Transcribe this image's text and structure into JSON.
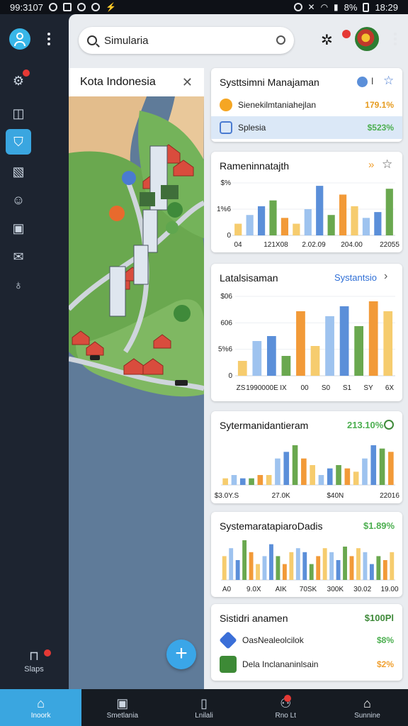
{
  "status_bar": {
    "time_left": "99:3107",
    "battery": "8%",
    "time_right": "18:29"
  },
  "search": {
    "placeholder": "Simularia"
  },
  "map": {
    "title": "Kota Indonesia"
  },
  "cards": {
    "card1": {
      "title": "Systtsimni Manajaman",
      "rows": [
        {
          "label": "Sienekilmtaniahejlan",
          "value": "179.1%",
          "color": "#f5a623"
        },
        {
          "label": "Splesia",
          "value": "$523%",
          "color": "#4caf50"
        }
      ]
    },
    "card2": {
      "title": "Rameninnatajth"
    },
    "card3": {
      "title": "Latalsisaman",
      "action": "Systantsio"
    },
    "card4": {
      "title": "Sytermanidantieram",
      "value": "213.10%"
    },
    "card5": {
      "title": "SystemaratapiaroDadis",
      "value": "$1.89%"
    },
    "card6": {
      "title": "Sistidri anamen",
      "value": "$100Pl",
      "rows": [
        {
          "label": "OasNealeolcilok",
          "value": "$8%"
        },
        {
          "label": "Dela Inclananinlsain",
          "value": "$2%"
        }
      ]
    }
  },
  "chart_data": [
    {
      "type": "bar",
      "title": "Rameninnatajth",
      "y_ticks": [
        "$%",
        "1%6",
        "0"
      ],
      "x_ticks": [
        "04",
        "121X08",
        "2.02.09",
        "204.00",
        "22055"
      ],
      "values": [
        2,
        3.5,
        5,
        6,
        3,
        2,
        4.5,
        8.5,
        3.5,
        7,
        5,
        3,
        4,
        8
      ]
    },
    {
      "type": "bar",
      "title": "Latalsisaman",
      "y_ticks": [
        "$06",
        "606",
        "5%6",
        "0"
      ],
      "x_ticks": [
        "ZS",
        "1990000E",
        "IX",
        "00",
        "S0",
        "S1",
        "SY",
        "6X"
      ],
      "values": [
        1.5,
        3.5,
        4,
        2,
        6.5,
        3,
        6,
        7,
        5,
        7.5,
        6.5
      ]
    },
    {
      "type": "bar",
      "title": "Sytermanidantieram",
      "x_ticks": [
        "$3.0Y.S",
        "27.0K",
        "$40N",
        "22016"
      ],
      "values": [
        1,
        1.5,
        1,
        1,
        1.5,
        1.5,
        4,
        5,
        6,
        4,
        3,
        1.5,
        2.5,
        3,
        2.5,
        2,
        4,
        6,
        5.5,
        5
      ]
    },
    {
      "type": "bar",
      "title": "SystemaratapiaroDadis",
      "x_ticks": [
        "A0",
        "9.0X",
        "AIK",
        "70SK",
        "300K",
        "30.02",
        "19.00"
      ],
      "values": [
        3,
        4,
        2.5,
        5,
        3.5,
        2,
        3,
        4.5,
        3,
        2,
        3.5,
        4,
        3.5,
        2,
        3,
        4,
        3.5,
        2.5,
        4.2,
        3,
        4,
        3.5,
        2,
        3,
        2.5,
        3.5
      ]
    }
  ],
  "bottom_nav": [
    {
      "label": "Inoork",
      "active": true
    },
    {
      "label": "Smetlania",
      "active": false
    },
    {
      "label": "Lnilali",
      "active": false
    },
    {
      "label": "Rno Lt",
      "active": false,
      "badge": true
    },
    {
      "label": "Sunnine",
      "active": false
    }
  ],
  "rail": {
    "bottom_label": "Slaps"
  },
  "colors": {
    "accent": "#3aa6e0",
    "blue": "#5b8fd9",
    "light_blue": "#9ec3ef",
    "yellow": "#f6cc6e",
    "orange": "#f29a38",
    "green": "#6aa84f",
    "badge_red": "#e53935"
  }
}
